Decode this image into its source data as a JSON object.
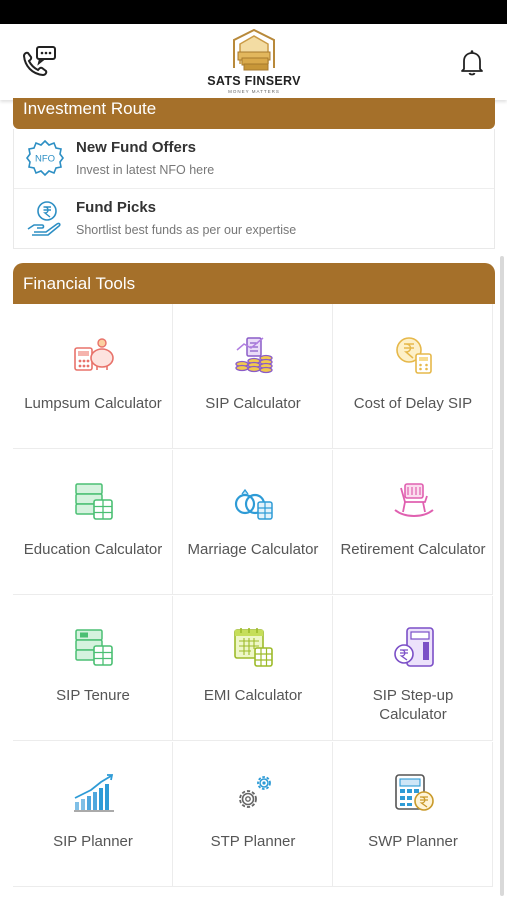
{
  "header": {
    "brand": "SATS FINSERV",
    "tagline": "MONEY MATTERS"
  },
  "investment_route": {
    "title": "Investment Route",
    "items": [
      {
        "title": "New Fund Offers",
        "subtitle": "Invest in latest NFO here",
        "icon": "nfo-badge-icon",
        "badge": "NFO"
      },
      {
        "title": "Fund Picks",
        "subtitle": "Shortlist best funds as per our expertise",
        "icon": "rupee-hand-icon"
      }
    ]
  },
  "financial_tools": {
    "title": "Financial Tools",
    "items": [
      {
        "label": "Lumpsum Calculator",
        "icon": "piggy-bank-calculator-icon"
      },
      {
        "label": "SIP Calculator",
        "icon": "coins-chart-icon"
      },
      {
        "label": "Cost of Delay SIP",
        "icon": "rupee-clock-calculator-icon"
      },
      {
        "label": "Education Calculator",
        "icon": "education-calculator-icon"
      },
      {
        "label": "Marriage Calculator",
        "icon": "rings-calculator-icon"
      },
      {
        "label": "Retirement Calculator",
        "icon": "rocking-chair-icon"
      },
      {
        "label": "SIP Tenure",
        "icon": "tenure-calculator-icon"
      },
      {
        "label": "EMI Calculator",
        "icon": "calendar-calculator-icon"
      },
      {
        "label": "SIP Step-up Calculator",
        "icon": "stepup-calculator-icon"
      },
      {
        "label": "SIP Planner",
        "icon": "growth-bars-icon"
      },
      {
        "label": "STP Planner",
        "icon": "gears-icon"
      },
      {
        "label": "SWP Planner",
        "icon": "rupee-calculator-icon"
      }
    ]
  },
  "colors": {
    "section_header": "#a5702a",
    "lumpsum": "#e8726a",
    "sip": "#8a5cc7",
    "delay": "#e6b84a",
    "education": "#4bbf73",
    "marriage": "#2e9bd6",
    "retirement": "#e060b0"
  }
}
